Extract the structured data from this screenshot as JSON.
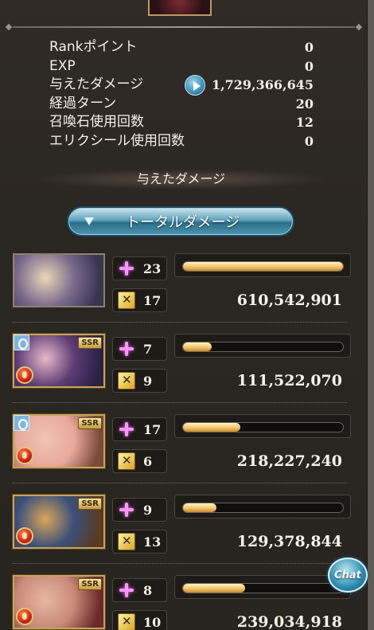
{
  "summary": {
    "rows": [
      {
        "label": "Rankポイント",
        "value": "0"
      },
      {
        "label": "EXP",
        "value": "0"
      },
      {
        "label": "与えたダメージ",
        "value": "1,729,366,645",
        "has_play_icon": true
      },
      {
        "label": "経過ターン",
        "value": "20"
      },
      {
        "label": "召喚石使用回数",
        "value": "12"
      },
      {
        "label": "エリクシール使用回数",
        "value": "0"
      }
    ]
  },
  "section_title": "与えたダメージ",
  "total_button_label": "トータルダメージ",
  "characters": [
    {
      "skill_count": "23",
      "ougi_count": "17",
      "damage": "610,542,901",
      "bar_fraction": 1.0,
      "ssr": false,
      "summon": false,
      "element": false,
      "art": [
        "#3a3450",
        "#e9d7b7",
        "#7a6a8c"
      ]
    },
    {
      "skill_count": "7",
      "ougi_count": "9",
      "damage": "111,522,070",
      "bar_fraction": 0.18,
      "ssr": true,
      "ssr_label": "SSR",
      "summon": true,
      "element": true,
      "art": [
        "#2b2145",
        "#e8b9c9",
        "#5d3c74"
      ]
    },
    {
      "skill_count": "17",
      "ougi_count": "6",
      "damage": "218,227,240",
      "bar_fraction": 0.36,
      "ssr": true,
      "ssr_label": "SSR",
      "summon": true,
      "element": true,
      "art": [
        "#7a4a3a",
        "#f2c4b4",
        "#e7a99a"
      ]
    },
    {
      "skill_count": "9",
      "ougi_count": "13",
      "damage": "129,378,844",
      "bar_fraction": 0.21,
      "ssr": true,
      "ssr_label": "SSR",
      "summon": false,
      "element": true,
      "art": [
        "#5a3a22",
        "#d9a65a",
        "#3a4f7a"
      ]
    },
    {
      "skill_count": "8",
      "ougi_count": "10",
      "damage": "239,034,918",
      "bar_fraction": 0.39,
      "ssr": true,
      "ssr_label": "SSR",
      "summon": false,
      "element": true,
      "art": [
        "#6a2a2a",
        "#e6b8a2",
        "#c98a78"
      ]
    }
  ],
  "chat_label": "Chat",
  "colors": {
    "bar_gold": "#f3c56b",
    "button_blue": "#2d6f8a",
    "chat_blue": "#2b8bb0"
  },
  "icons": [
    "play-icon",
    "skill-spark-icon",
    "ougi-icon",
    "fire-element-icon",
    "summon-icon",
    "ssr-badge"
  ]
}
